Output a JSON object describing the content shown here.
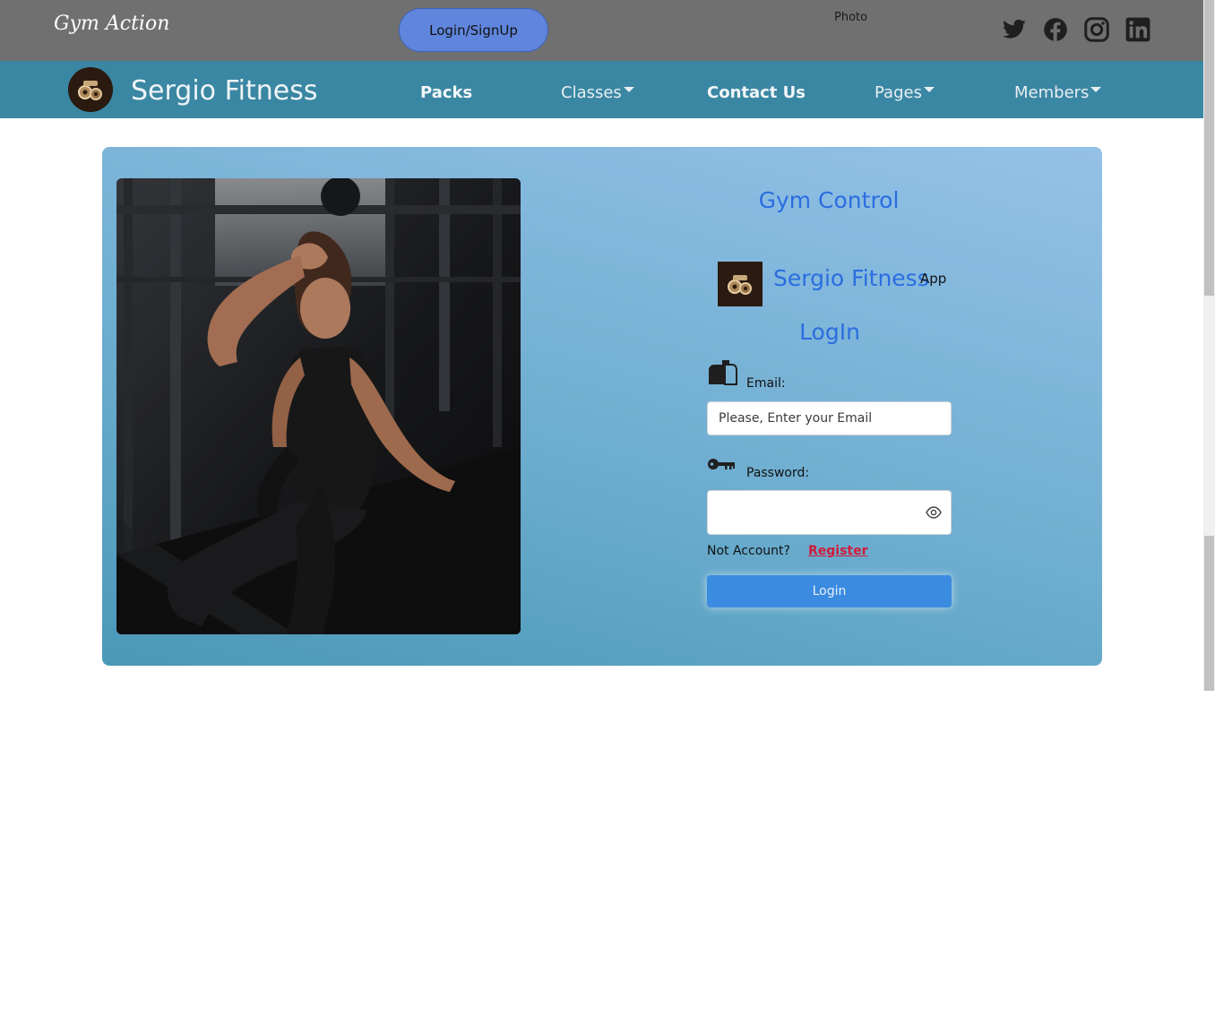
{
  "topbar": {
    "brand": "Gym Action",
    "login_signup": "Login/SignUp",
    "photo_label": "Photo",
    "social_icons": [
      "twitter-icon",
      "facebook-icon",
      "instagram-icon",
      "linkedin-icon"
    ],
    "background": "#707070"
  },
  "navbar": {
    "brand": "Sergio Fitness",
    "items": [
      {
        "label": "Packs",
        "dropdown": false
      },
      {
        "label": "Classes",
        "dropdown": true
      },
      {
        "label": "Contact Us",
        "dropdown": false
      },
      {
        "label": "Pages",
        "dropdown": true
      },
      {
        "label": "Members",
        "dropdown": true
      }
    ],
    "background": "#3a87a3"
  },
  "login_card": {
    "heading": "Gym Control",
    "app_name": "Sergio Fitness",
    "app_sup": "App",
    "title": "LogIn",
    "email_label": "Email:",
    "email_placeholder": "Please, Enter your Email",
    "email_value": "",
    "password_label": "Password:",
    "password_value": "",
    "not_account": "Not Account?",
    "register": "Register",
    "login_button": "Login",
    "accent_color": "#2b6de0",
    "register_color": "#d11a3a",
    "button_color": "#3b8be0"
  }
}
